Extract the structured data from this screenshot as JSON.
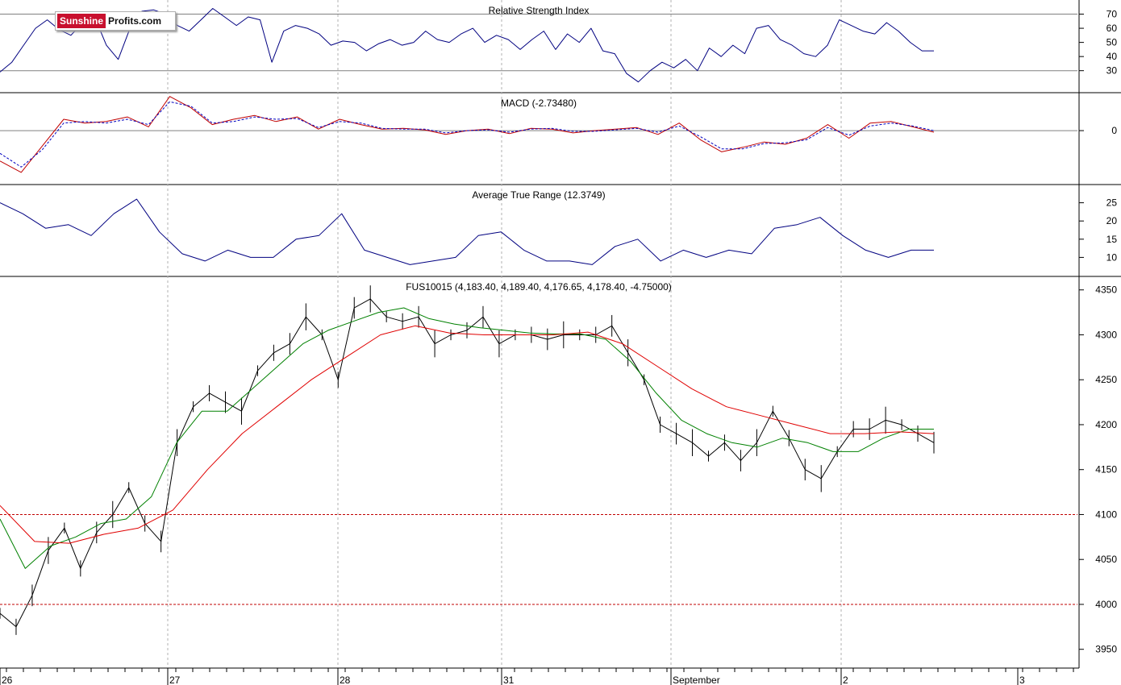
{
  "logo": {
    "part1": "Sunshine",
    "part2": "Profits.com"
  },
  "colors": {
    "price": "#000000",
    "rsi": "#000080",
    "macd": "#c00000",
    "signal": "#0000c0",
    "ma_fast": "#008000",
    "ma_slow": "#e00000",
    "ref_line": "#c00000",
    "grid": "#b0b0b0"
  },
  "chart_data": {
    "type": "line",
    "title": "FUS10015 (4,183.40, 4,189.40, 4,176.65, 4,178.40, -4.75000)",
    "x_tick_labels": [
      "26",
      "27",
      "28",
      "31",
      "September",
      "2",
      "3"
    ],
    "panels": [
      {
        "name": "Relative Strength Index",
        "title": "Relative Strength Index",
        "ylim": [
          15,
          80
        ],
        "y_ticks": [
          30,
          40,
          50,
          60,
          70
        ],
        "ref_lines": [
          70,
          30
        ],
        "series": [
          {
            "values": [
              29,
              36,
              48,
              60,
              66,
              59,
              55,
              64,
              68,
              48,
              38,
              60,
              72,
              73,
              70,
              62,
              58,
              66,
              74,
              68,
              62,
              68,
              66,
              36,
              58,
              62,
              60,
              56,
              48,
              51,
              50,
              44,
              49,
              52,
              48,
              50,
              58,
              52,
              50,
              56,
              60,
              50,
              55,
              52,
              45,
              52,
              58,
              45,
              56,
              50,
              60,
              44,
              42,
              28,
              22,
              30,
              36,
              32,
              38,
              30,
              46,
              40,
              48,
              42,
              60,
              62,
              52,
              48,
              42,
              40,
              48,
              66,
              62,
              58,
              56,
              64,
              58,
              50,
              44,
              44
            ]
          }
        ]
      },
      {
        "name": "MACD",
        "title": "MACD (-2.73480)",
        "ylim": [
          -70,
          50
        ],
        "y_ticks": [
          0
        ],
        "ref_lines": [
          0
        ],
        "series": [
          {
            "values": [
              -40,
              -55,
              -20,
              15,
              10,
              12,
              18,
              5,
              45,
              30,
              8,
              15,
              20,
              12,
              18,
              2,
              15,
              8,
              2,
              3,
              1,
              -5,
              0,
              2,
              -4,
              3,
              2,
              -3,
              0,
              2,
              4,
              -5,
              10,
              -12,
              -28,
              -22,
              -15,
              -18,
              -10,
              8,
              -10,
              10,
              12,
              5,
              -2
            ]
          },
          {
            "values": [
              -30,
              -48,
              -25,
              10,
              12,
              10,
              15,
              8,
              38,
              32,
              10,
              12,
              18,
              15,
              16,
              4,
              12,
              10,
              3,
              2,
              2,
              -3,
              0,
              1,
              -2,
              2,
              3,
              -1,
              -1,
              1,
              3,
              -2,
              6,
              -8,
              -24,
              -24,
              -17,
              -16,
              -12,
              4,
              -6,
              6,
              10,
              6,
              0
            ]
          }
        ]
      },
      {
        "name": "Average True Range",
        "title": "Average True Range (12.3749)",
        "ylim": [
          5,
          30
        ],
        "y_ticks": [
          10,
          15,
          20,
          25
        ],
        "series": [
          {
            "values": [
              25,
              22,
              18,
              19,
              16,
              22,
              26,
              17,
              11,
              9,
              12,
              10,
              10,
              15,
              16,
              22,
              12,
              10,
              8,
              9,
              10,
              16,
              17,
              12,
              9,
              9,
              8,
              13,
              15,
              9,
              12,
              10,
              12,
              11,
              18,
              19,
              21,
              16,
              12,
              10,
              12,
              12
            ]
          }
        ]
      },
      {
        "name": "FUS10015",
        "title": "FUS10015 (4,183.40, 4,189.40, 4,176.65, 4,178.40, -4.75000)",
        "ylim": [
          3930,
          4365
        ],
        "y_ticks": [
          3950,
          4000,
          4050,
          4100,
          4150,
          4200,
          4250,
          4300,
          4350
        ],
        "ref_lines": [
          4100,
          4000
        ],
        "series": [
          {
            "values": [
              3990,
              3975,
              4010,
              4060,
              4085,
              4040,
              4080,
              4100,
              4130,
              4090,
              4070,
              4180,
              4220,
              4235,
              4225,
              4215,
              4260,
              4280,
              4290,
              4320,
              4300,
              4250,
              4330,
              4340,
              4320,
              4315,
              4320,
              4290,
              4300,
              4305,
              4320,
              4290,
              4300,
              4300,
              4295,
              4300,
              4300,
              4300,
              4310,
              4280,
              4250,
              4200,
              4190,
              4180,
              4165,
              4180,
              4160,
              4180,
              4215,
              4185,
              4150,
              4140,
              4170,
              4195,
              4195,
              4205,
              4200,
              4190,
              4180
            ]
          },
          {
            "values": [
              4095,
              4040,
              4065,
              4075,
              4090,
              4095,
              4120,
              4180,
              4215,
              4215,
              4240,
              4265,
              4290,
              4305,
              4315,
              4325,
              4330,
              4318,
              4312,
              4308,
              4305,
              4302,
              4301,
              4301,
              4295,
              4270,
              4235,
              4205,
              4190,
              4180,
              4175,
              4185,
              4180,
              4170,
              4170,
              4185,
              4195,
              4195
            ]
          },
          {
            "values": [
              4110,
              4070,
              4068,
              4078,
              4085,
              4105,
              4150,
              4190,
              4220,
              4250,
              4275,
              4300,
              4310,
              4302,
              4300,
              4300,
              4300,
              4303,
              4290,
              4265,
              4240,
              4220,
              4210,
              4200,
              4190,
              4190,
              4192,
              4190
            ]
          }
        ]
      }
    ]
  }
}
